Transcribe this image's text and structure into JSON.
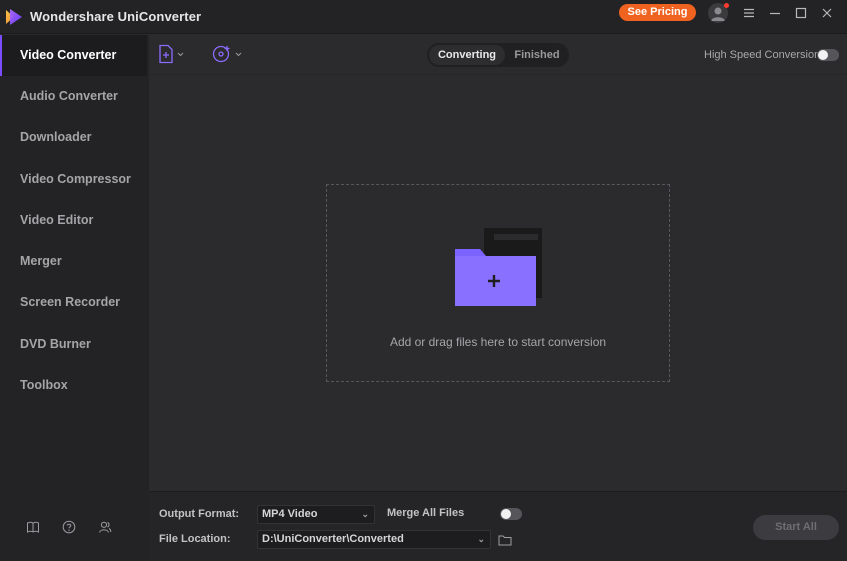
{
  "app": {
    "title": "Wondershare UniConverter"
  },
  "titlebar": {
    "pricing_label": "See Pricing"
  },
  "sidebar": {
    "items": [
      {
        "label": "Video Converter",
        "active": true
      },
      {
        "label": "Audio Converter",
        "active": false
      },
      {
        "label": "Downloader",
        "active": false
      },
      {
        "label": "Video Compressor",
        "active": false
      },
      {
        "label": "Video Editor",
        "active": false
      },
      {
        "label": "Merger",
        "active": false
      },
      {
        "label": "Screen Recorder",
        "active": false
      },
      {
        "label": "DVD Burner",
        "active": false
      },
      {
        "label": "Toolbox",
        "active": false
      }
    ],
    "footer_icons": [
      "book-icon",
      "help-icon",
      "account-icon"
    ]
  },
  "toolbar": {
    "add_file_icon": "add-file-icon",
    "add_dvd_icon": "add-dvd-icon",
    "tabs": [
      {
        "label": "Converting",
        "active": true
      },
      {
        "label": "Finished",
        "active": false
      }
    ],
    "high_speed_label": "High Speed Conversion",
    "high_speed_on": false
  },
  "dropzone": {
    "text": "Add or drag files here to start conversion"
  },
  "bottom": {
    "output_format_label": "Output Format:",
    "output_format_value": "MP4 Video",
    "merge_label": "Merge All Files",
    "merge_on": false,
    "file_location_label": "File Location:",
    "file_location_value": "D:\\UniConverter\\Converted",
    "start_all_label": "Start All"
  },
  "colors": {
    "accent_purple": "#7c4dff",
    "pricing_orange": "#f0621f",
    "background": "#2b2b2d",
    "sidebar": "#232325"
  }
}
